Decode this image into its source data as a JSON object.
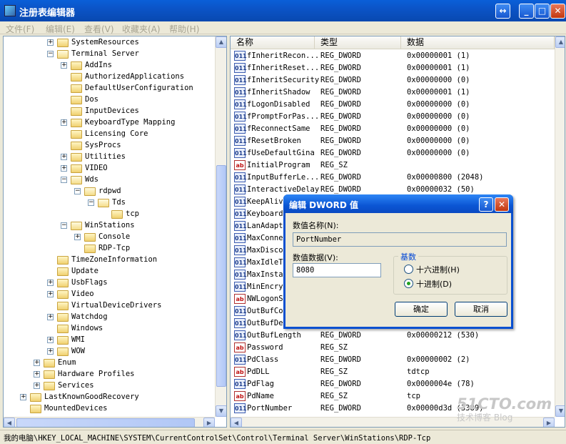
{
  "window": {
    "title": "注册表编辑器",
    "restore_glyph": "↔",
    "min_glyph": "_",
    "max_glyph": "□",
    "close_glyph": "✕"
  },
  "menu": [
    "文件(F)",
    "编辑(E)",
    "查看(V)",
    "收藏夹(A)",
    "帮助(H)"
  ],
  "tree": [
    {
      "label": "SystemResources",
      "depth": 2,
      "expander": "+"
    },
    {
      "label": "Terminal Server",
      "depth": 2,
      "expander": "-"
    },
    {
      "label": "AddIns",
      "depth": 3,
      "expander": "+"
    },
    {
      "label": "AuthorizedApplications",
      "depth": 3,
      "expander": ""
    },
    {
      "label": "DefaultUserConfiguration",
      "depth": 3,
      "expander": ""
    },
    {
      "label": "Dos",
      "depth": 3,
      "expander": ""
    },
    {
      "label": "InputDevices",
      "depth": 3,
      "expander": ""
    },
    {
      "label": "KeyboardType Mapping",
      "depth": 3,
      "expander": "+"
    },
    {
      "label": "Licensing Core",
      "depth": 3,
      "expander": ""
    },
    {
      "label": "SysProcs",
      "depth": 3,
      "expander": ""
    },
    {
      "label": "Utilities",
      "depth": 3,
      "expander": "+"
    },
    {
      "label": "VIDEO",
      "depth": 3,
      "expander": "+"
    },
    {
      "label": "Wds",
      "depth": 3,
      "expander": "-"
    },
    {
      "label": "rdpwd",
      "depth": 4,
      "expander": "-"
    },
    {
      "label": "Tds",
      "depth": 5,
      "expander": "-"
    },
    {
      "label": "tcp",
      "depth": 6,
      "expander": ""
    },
    {
      "label": "WinStations",
      "depth": 3,
      "expander": "-"
    },
    {
      "label": "Console",
      "depth": 4,
      "expander": "+"
    },
    {
      "label": "RDP-Tcp",
      "depth": 4,
      "expander": ""
    },
    {
      "label": "TimeZoneInformation",
      "depth": 2,
      "expander": ""
    },
    {
      "label": "Update",
      "depth": 2,
      "expander": ""
    },
    {
      "label": "UsbFlags",
      "depth": 2,
      "expander": "+"
    },
    {
      "label": "Video",
      "depth": 2,
      "expander": "+"
    },
    {
      "label": "VirtualDeviceDrivers",
      "depth": 2,
      "expander": ""
    },
    {
      "label": "Watchdog",
      "depth": 2,
      "expander": "+"
    },
    {
      "label": "Windows",
      "depth": 2,
      "expander": ""
    },
    {
      "label": "WMI",
      "depth": 2,
      "expander": "+"
    },
    {
      "label": "WOW",
      "depth": 2,
      "expander": "+"
    },
    {
      "label": "Enum",
      "depth": 1,
      "expander": "+"
    },
    {
      "label": "Hardware Profiles",
      "depth": 1,
      "expander": "+"
    },
    {
      "label": "Services",
      "depth": 1,
      "expander": "+"
    },
    {
      "label": "LastKnownGoodRecovery",
      "depth": 0,
      "expander": "+"
    },
    {
      "label": "MountedDevices",
      "depth": 0,
      "expander": ""
    }
  ],
  "columns": {
    "name": "名称",
    "type": "类型",
    "data": "数据"
  },
  "values": [
    {
      "icon": "dw",
      "name": "fInheritRecon...",
      "type": "REG_DWORD",
      "data": "0x00000001 (1)"
    },
    {
      "icon": "dw",
      "name": "fInheritReset...",
      "type": "REG_DWORD",
      "data": "0x00000001 (1)"
    },
    {
      "icon": "dw",
      "name": "fInheritSecurity",
      "type": "REG_DWORD",
      "data": "0x00000000 (0)"
    },
    {
      "icon": "dw",
      "name": "fInheritShadow",
      "type": "REG_DWORD",
      "data": "0x00000001 (1)"
    },
    {
      "icon": "dw",
      "name": "fLogonDisabled",
      "type": "REG_DWORD",
      "data": "0x00000000 (0)"
    },
    {
      "icon": "dw",
      "name": "fPromptForPas...",
      "type": "REG_DWORD",
      "data": "0x00000000 (0)"
    },
    {
      "icon": "dw",
      "name": "fReconnectSame",
      "type": "REG_DWORD",
      "data": "0x00000000 (0)"
    },
    {
      "icon": "dw",
      "name": "fResetBroken",
      "type": "REG_DWORD",
      "data": "0x00000000 (0)"
    },
    {
      "icon": "dw",
      "name": "fUseDefaultGina",
      "type": "REG_DWORD",
      "data": "0x00000000 (0)"
    },
    {
      "icon": "sz",
      "name": "InitialProgram",
      "type": "REG_SZ",
      "data": ""
    },
    {
      "icon": "dw",
      "name": "InputBufferLe...",
      "type": "REG_DWORD",
      "data": "0x00000800 (2048)"
    },
    {
      "icon": "dw",
      "name": "InteractiveDelay",
      "type": "REG_DWORD",
      "data": "0x00000032 (50)"
    },
    {
      "icon": "dw",
      "name": "KeepAlive",
      "type": "",
      "data": ""
    },
    {
      "icon": "dw",
      "name": "KeyboardL",
      "type": "",
      "data": ""
    },
    {
      "icon": "dw",
      "name": "LanAdapte",
      "type": "",
      "data": ""
    },
    {
      "icon": "dw",
      "name": "MaxConnec",
      "type": "",
      "data": ""
    },
    {
      "icon": "dw",
      "name": "MaxDiscon",
      "type": "",
      "data": ""
    },
    {
      "icon": "dw",
      "name": "MaxIdleTi",
      "type": "",
      "data": ""
    },
    {
      "icon": "dw",
      "name": "MaxInstan",
      "type": "",
      "data": ""
    },
    {
      "icon": "dw",
      "name": "MinEncryp",
      "type": "",
      "data": ""
    },
    {
      "icon": "sz",
      "name": "NWLogonSe",
      "type": "",
      "data": ""
    },
    {
      "icon": "dw",
      "name": "OutBufCou",
      "type": "",
      "data": ""
    },
    {
      "icon": "dw",
      "name": "OutBufDel",
      "type": "",
      "data": ""
    },
    {
      "icon": "dw",
      "name": "OutBufLength",
      "type": "REG_DWORD",
      "data": "0x00000212 (530)"
    },
    {
      "icon": "sz",
      "name": "Password",
      "type": "REG_SZ",
      "data": ""
    },
    {
      "icon": "dw",
      "name": "PdClass",
      "type": "REG_DWORD",
      "data": "0x00000002 (2)"
    },
    {
      "icon": "sz",
      "name": "PdDLL",
      "type": "REG_SZ",
      "data": "tdtcp"
    },
    {
      "icon": "dw",
      "name": "PdFlag",
      "type": "REG_DWORD",
      "data": "0x0000004e (78)"
    },
    {
      "icon": "sz",
      "name": "PdName",
      "type": "REG_SZ",
      "data": "tcp"
    },
    {
      "icon": "dw",
      "name": "PortNumber",
      "type": "REG_DWORD",
      "data": "0x00000d3d (3389)"
    }
  ],
  "icon_glyphs": {
    "dw": "011",
    "sz": "ab"
  },
  "statusbar": "我的电脑\\HKEY_LOCAL_MACHINE\\SYSTEM\\CurrentControlSet\\Control\\Terminal Server\\WinStations\\RDP-Tcp",
  "dialog": {
    "title": "编辑 DWORD 值",
    "help": "?",
    "close": "✕",
    "name_label": "数值名称(N):",
    "name_value": "PortNumber",
    "data_label": "数值数据(V):",
    "data_value": "8080",
    "base_label": "基数",
    "hex_label": "十六进制(H)",
    "dec_label": "十进制(D)",
    "selected_base": "dec",
    "ok": "确定",
    "cancel": "取消"
  },
  "watermark": {
    "line1": "51CTO.com",
    "line2": "技术博客",
    "line3": "Blog"
  }
}
